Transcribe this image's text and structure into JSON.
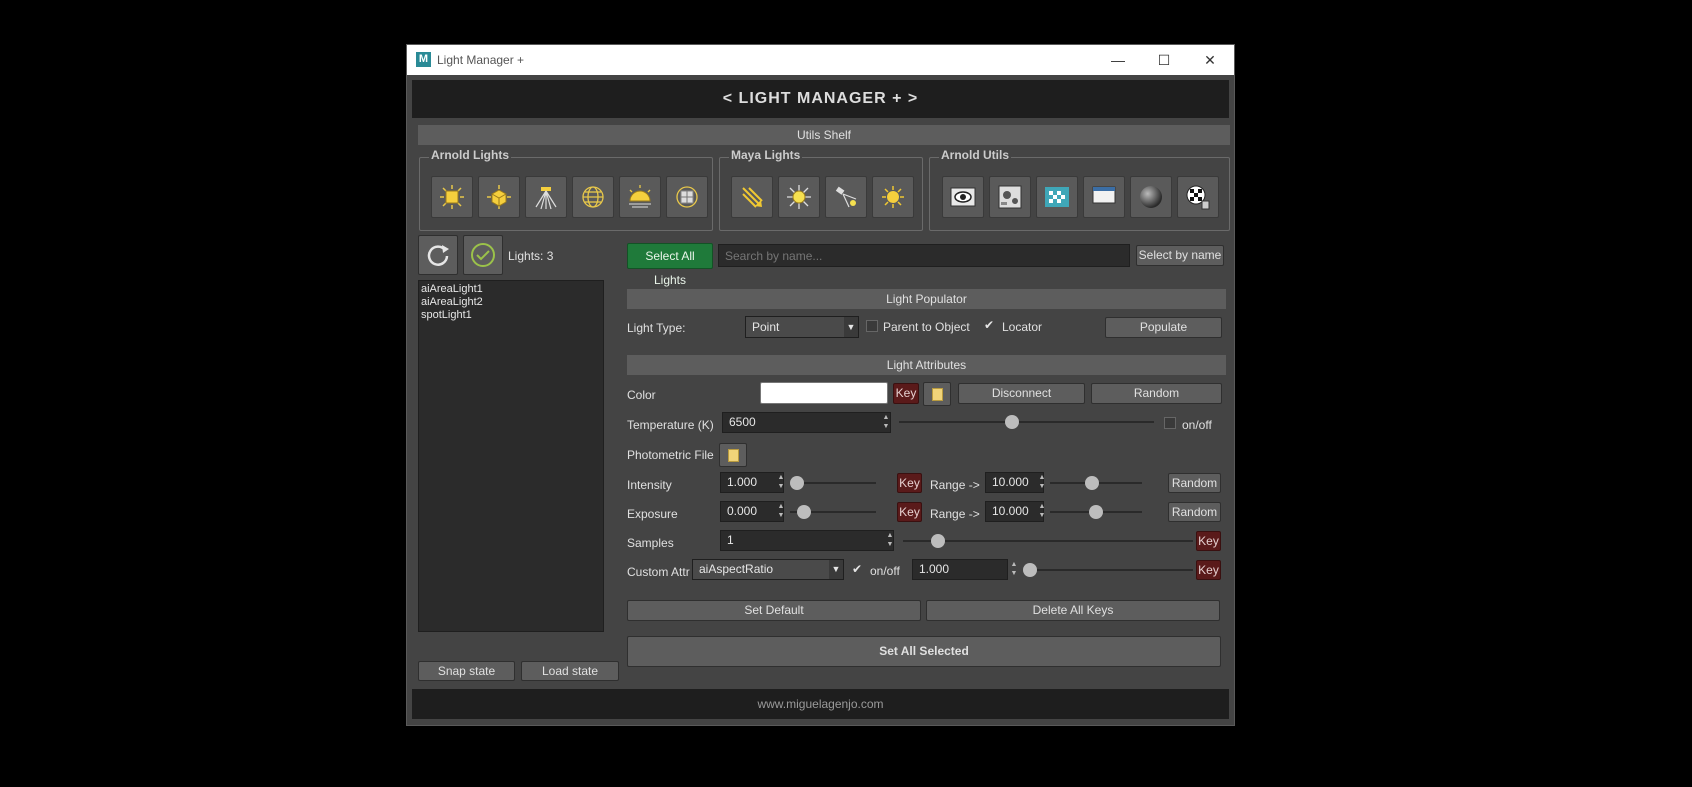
{
  "window": {
    "title": "Light Manager +",
    "controls": {
      "minimize": "—",
      "maximize": "☐",
      "close": "✕"
    }
  },
  "header": {
    "title": "< LIGHT MANAGER + >"
  },
  "utils_shelf": {
    "label": "Utils Shelf",
    "groups": [
      {
        "label": "Arnold Lights",
        "icons": [
          "ai-area-light-icon",
          "ai-mesh-light-icon",
          "ai-photometric-light-icon",
          "ai-skydome-light-icon",
          "ai-physical-sky-icon",
          "ai-light-portal-icon"
        ]
      },
      {
        "label": "Maya Lights",
        "icons": [
          "directional-light-icon",
          "point-light-icon",
          "spot-light-icon",
          "ambient-light-icon"
        ]
      },
      {
        "label": "Arnold Utils",
        "icons": [
          "render-view-icon",
          "render-settings-icon",
          "texture-tx-icon",
          "window-icon",
          "material-sphere-icon",
          "checker-shader-icon"
        ]
      }
    ]
  },
  "light_list": {
    "count_label": "Lights: 3",
    "items": [
      "aiAreaLight1",
      "aiAreaLight2",
      "spotLight1"
    ],
    "snap_label": "Snap state",
    "load_label": "Load state"
  },
  "search": {
    "select_all_label": "Select All Lights",
    "placeholder": "Search by name...",
    "select_by_name_label": "Select by name"
  },
  "populator": {
    "section_label": "Light Populator",
    "light_type_label": "Light Type:",
    "light_type_value": "Point",
    "parent_label": "Parent to Object",
    "parent_checked": false,
    "locator_label": "Locator",
    "locator_checked": true,
    "populate_label": "Populate"
  },
  "attributes": {
    "section_label": "Light Attributes",
    "color": {
      "label": "Color",
      "value": "#ffffff",
      "key_label": "Key",
      "disconnect_label": "Disconnect",
      "random_label": "Random"
    },
    "temperature": {
      "label": "Temperature (K)",
      "value": "6500",
      "slider_fraction": 0.44,
      "toggle_label": "on/off",
      "toggle_checked": false
    },
    "photometric": {
      "label": "Photometric File"
    },
    "intensity": {
      "label": "Intensity",
      "value": "1.000",
      "slider_fraction": 0.0,
      "key_label": "Key",
      "range_label": "Range ->",
      "range_value": "10.000",
      "range_slider_fraction": 0.45,
      "random_label": "Random"
    },
    "exposure": {
      "label": "Exposure",
      "value": "0.000",
      "slider_fraction": 0.1,
      "key_label": "Key",
      "range_label": "Range ->",
      "range_value": "10.000",
      "range_slider_fraction": 0.5,
      "random_label": "Random"
    },
    "samples": {
      "label": "Samples",
      "value": "1",
      "slider_fraction": 0.1,
      "key_label": "Key"
    },
    "custom": {
      "label": "Custom Attr",
      "attr_value": "aiAspectRatio",
      "toggle_label": "on/off",
      "toggle_checked": true,
      "value": "1.000",
      "slider_fraction": 0.0,
      "key_label": "Key"
    },
    "set_default_label": "Set Default",
    "delete_keys_label": "Delete All Keys",
    "set_all_label": "Set All Selected"
  },
  "footer": {
    "text": "www.miguelagenjo.com"
  },
  "colors": {
    "select_all_green": "#1f7a3a",
    "key_red": "#5a1a1a",
    "folder_yellow": "#f1d479"
  }
}
